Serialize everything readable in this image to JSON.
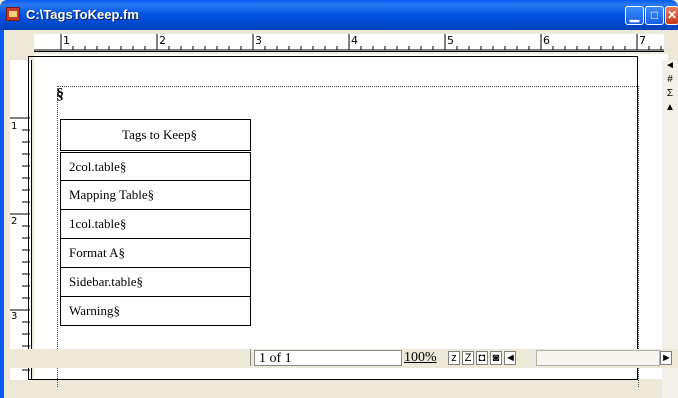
{
  "window": {
    "title": "C:\\TagsToKeep.fm",
    "minimize_icon": "minimize-icon",
    "maximize_icon": "maximize-icon",
    "close_icon": "close-icon"
  },
  "ruler": {
    "horizontal_marks": [
      "1",
      "2",
      "3",
      "4",
      "5",
      "6",
      "7"
    ],
    "vertical_marks": [
      "1",
      "2",
      "3"
    ]
  },
  "document": {
    "paragraph_mark": "§",
    "table": {
      "header": "Tags to Keep§",
      "rows": [
        "2col.table§",
        "Mapping Table§",
        "1col.table§",
        "Format A§",
        "Sidebar.table§",
        "Warning§"
      ]
    }
  },
  "statusbar": {
    "page": "1 of 1",
    "zoom": "100%",
    "zoom_out": "z",
    "zoom_in": "Z",
    "fit_page": "◘",
    "fit_window": "◙",
    "scroll_left": "◄",
    "scroll_right": "►"
  },
  "sidebar_buttons": [
    "◄",
    "#",
    "Σ",
    "▲"
  ]
}
